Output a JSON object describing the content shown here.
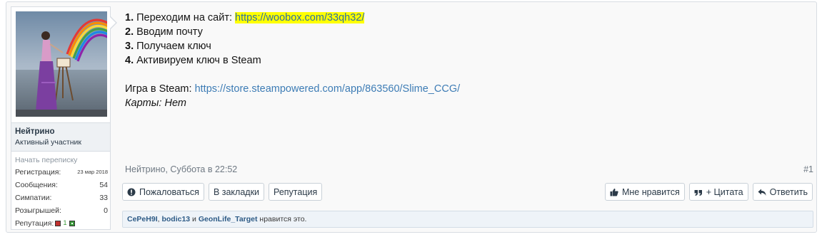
{
  "user": {
    "name": "Нейтрино",
    "title": "Активный участник",
    "start_conversation": "Начать переписку",
    "stats": [
      {
        "label": "Регистрация:",
        "value": "23 мар 2018"
      },
      {
        "label": "Сообщения:",
        "value": "54"
      },
      {
        "label": "Симпатии:",
        "value": "33"
      },
      {
        "label": "Розыгрышей:",
        "value": "0"
      }
    ],
    "reputation_label": "Репутация:",
    "reputation_value": "1"
  },
  "message": {
    "steps": [
      {
        "num": "1.",
        "text": "Переходим на сайт: ",
        "link": "https://woobox.com/33qh32/"
      },
      {
        "num": "2.",
        "text": "Вводим почту"
      },
      {
        "num": "3.",
        "text": "Получаем ключ"
      },
      {
        "num": "4.",
        "text": "Активируем ключ в Steam"
      }
    ],
    "game_label": "Игра в Steam: ",
    "game_link": "https://store.steampowered.com/app/863560/Slime_CCG/",
    "cards": "Карты: Нет"
  },
  "meta": {
    "author_time": "Нейтрино, Суббота в 22:52",
    "post_number": "#1"
  },
  "actions_left": [
    {
      "label": "Пожаловаться",
      "icon": "exclamation-circle-icon"
    },
    {
      "label": "В закладки"
    },
    {
      "label": "Репутация"
    }
  ],
  "actions_right": [
    {
      "label": "Мне нравится",
      "icon": "thumbs-up-icon"
    },
    {
      "label": "+ Цитата",
      "icon": "quote-icon"
    },
    {
      "label": "Ответить",
      "icon": "reply-icon"
    }
  ],
  "likes": {
    "users": [
      "CePeH9I",
      "bodic13",
      "GeonLife_Target"
    ],
    "separator": ", ",
    "and": " и ",
    "suffix": " нравится это."
  },
  "colors": {
    "highlight": "#ffff00",
    "link": "#3d7cb5",
    "rep_negative": "#c0302e",
    "rep_positive": "#3a9a3a"
  }
}
